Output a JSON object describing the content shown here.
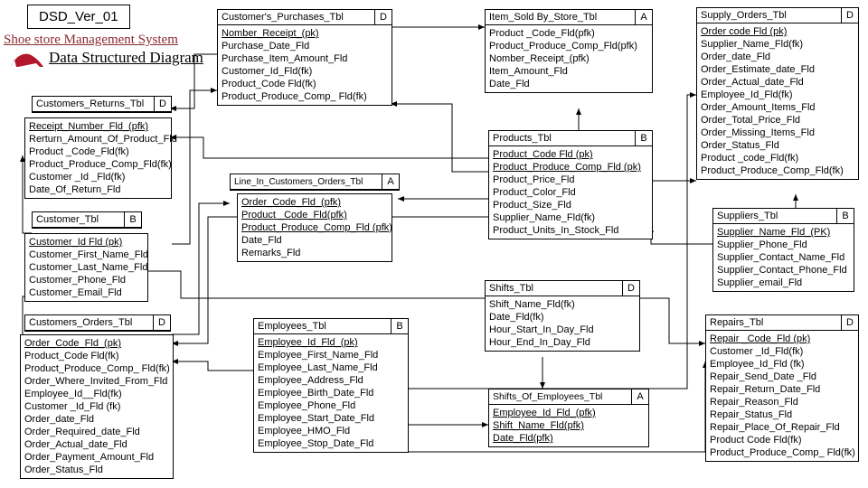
{
  "version": "DSD_Ver_01",
  "titles": {
    "project": "Shoe store Management System",
    "subtitle": "Data Structured Diagram"
  },
  "tables": {
    "customers_returns": {
      "title": "Customers_Returns_Tbl",
      "tag": "D",
      "fields": [
        "Receipt_Number_Fld_(pfk)",
        "Rerturn_Amount_Of_Product_Fld",
        "Product _Code_Fld(fk)",
        "Product_Produce_Comp_Fld(fk)",
        "Customer _Id _Fld(fk)",
        "Date_Of_Return_Fld"
      ]
    },
    "customer": {
      "title": "Customer_Tbl",
      "tag": "B",
      "fields": [
        "Customer_Id Fld (pk)",
        "Customer_First_Name_Fld",
        "Customer_Last_Name_Fld",
        "Customer_Phone_Fld",
        "Customer_Email_Fld"
      ]
    },
    "customers_orders": {
      "title": "Customers_Orders_Tbl",
      "tag": "D",
      "fields": [
        "Order_Code_Fld_(pk)",
        "Product_Code Fld(fk)",
        "Product_Produce_Comp_ Fld(fk)",
        "Order_Where_Invited_From_Fld",
        "Employee_Id__Fld(fk)",
        "Customer _Id_Fld (fk)",
        "Order_date_Fld",
        "Order_Required_date_Fld",
        "Order_Actual_date_Fld",
        "Order_Payment_Amount_Fld",
        "Order_Status_Fld"
      ]
    },
    "customers_purchases": {
      "title": "Customer's_Purchases_Tbl",
      "tag": "D",
      "fields": [
        "Nomber_Receipt_(pk)",
        "Purchase_Date_Fld",
        "Purchase_Item_Amount_Fld",
        "Customer_Id_Fld(fk)",
        "Product_Code Fld(fk)",
        "Product_Produce_Comp_ Fld(fk)"
      ]
    },
    "line_in_orders": {
      "title": "Line_In_Customers_Orders_Tbl",
      "tag": "A",
      "fields": [
        "Order_Code_Fld_(pfk)",
        "Product _Code_Fld(pfk)",
        "Product_Produce_Comp_Fld (pfk)",
        "Date_Fld",
        "Remarks_Fld"
      ]
    },
    "employees": {
      "title": "Employees_Tbl",
      "tag": "B",
      "fields": [
        "Employee_Id_Fld_(pk)",
        "Employee_First_Name_Fld",
        "Employee_Last_Name_Fld",
        "Employee_Address_Fld",
        "Employee_Birth_Date_Fld",
        "Employee_Phone_Fld",
        "Employee_Start_Date_Fld",
        "Employee_HMO_Fld",
        "Employee_Stop_Date_Fld"
      ]
    },
    "item_sold": {
      "title": "Item_Sold By_Store_Tbl",
      "tag": "A",
      "fields": [
        "Product _Code_Fld(pfk)",
        "Product_Produce_Comp_Fld(pfk)",
        "Nomber_Receipt_(pfk)",
        "Item_Amount_Fld",
        "Date_Fld"
      ]
    },
    "products": {
      "title": "Products_Tbl",
      "tag": "B",
      "fields": [
        "Product_Code Fld (pk)",
        "Product_Produce_Comp_Fld (pk)",
        "Product_Price_Fld",
        "Product_Color_Fld",
        "Product_Size_Fld",
        "Supplier_Name_Fld(fk)",
        "Product_Units_In_Stock_Fld"
      ]
    },
    "shifts": {
      "title": "Shifts_Tbl",
      "tag": "D",
      "fields": [
        "Shift_Name_Fld(fk)",
        "Date_Fld(fk)",
        "Hour_Start_In_Day_Fld",
        "Hour_End_In_Day_Fld"
      ]
    },
    "shifts_emp": {
      "title": "Shifts_Of_Employees_Tbl",
      "tag": "A",
      "fields": [
        "Employee_Id_Fld_(pfk)",
        "Shift_Name_Fld(pfk)",
        "Date_Fld(pfk)"
      ]
    },
    "supply_orders": {
      "title": "Supply_Orders_Tbl",
      "tag": "D",
      "fields": [
        "Order code Fld (pk)",
        "Supplier_Name_Fld(fk)",
        "Order_date_Fld",
        "Order_Estimate_date_Fld",
        "Order_Actual_date_Fld",
        "Employee_Id_Fld(fk)",
        "Order_Amount_Items_Fld",
        "Order_Total_Price_Fld",
        "Order_Missing_Items_Fld",
        "Order_Status_Fld",
        "Product _code_Fld(fk)",
        "Product_Produce_Comp_Fld(fk)"
      ]
    },
    "suppliers": {
      "title": "Suppliers_Tbl",
      "tag": "B",
      "fields": [
        "Supplier_Name_Fld_(PK)",
        "Supplier_Phone_Fld",
        "Supplier_Contact_Name_Fld",
        "Supplier_Contact_Phone_Fld",
        "Supplier_email_Fld"
      ]
    },
    "repairs": {
      "title": "Repairs_Tbl",
      "tag": "D",
      "fields": [
        "Repair _Code_Fld (pk)",
        "Customer _Id_Fld(fk)",
        "Employee_Id_Fld (fk)",
        "Repair_Send_Date _Fld",
        "Repair_Return_Date_Fld",
        "Repair_Reason_Fld",
        "Repair_Status_Fld",
        "Repair_Place_Of_Repair_Fld",
        "Product Code Fld(fk)",
        "Product_Produce_Comp_ Fld(fk)"
      ]
    }
  }
}
